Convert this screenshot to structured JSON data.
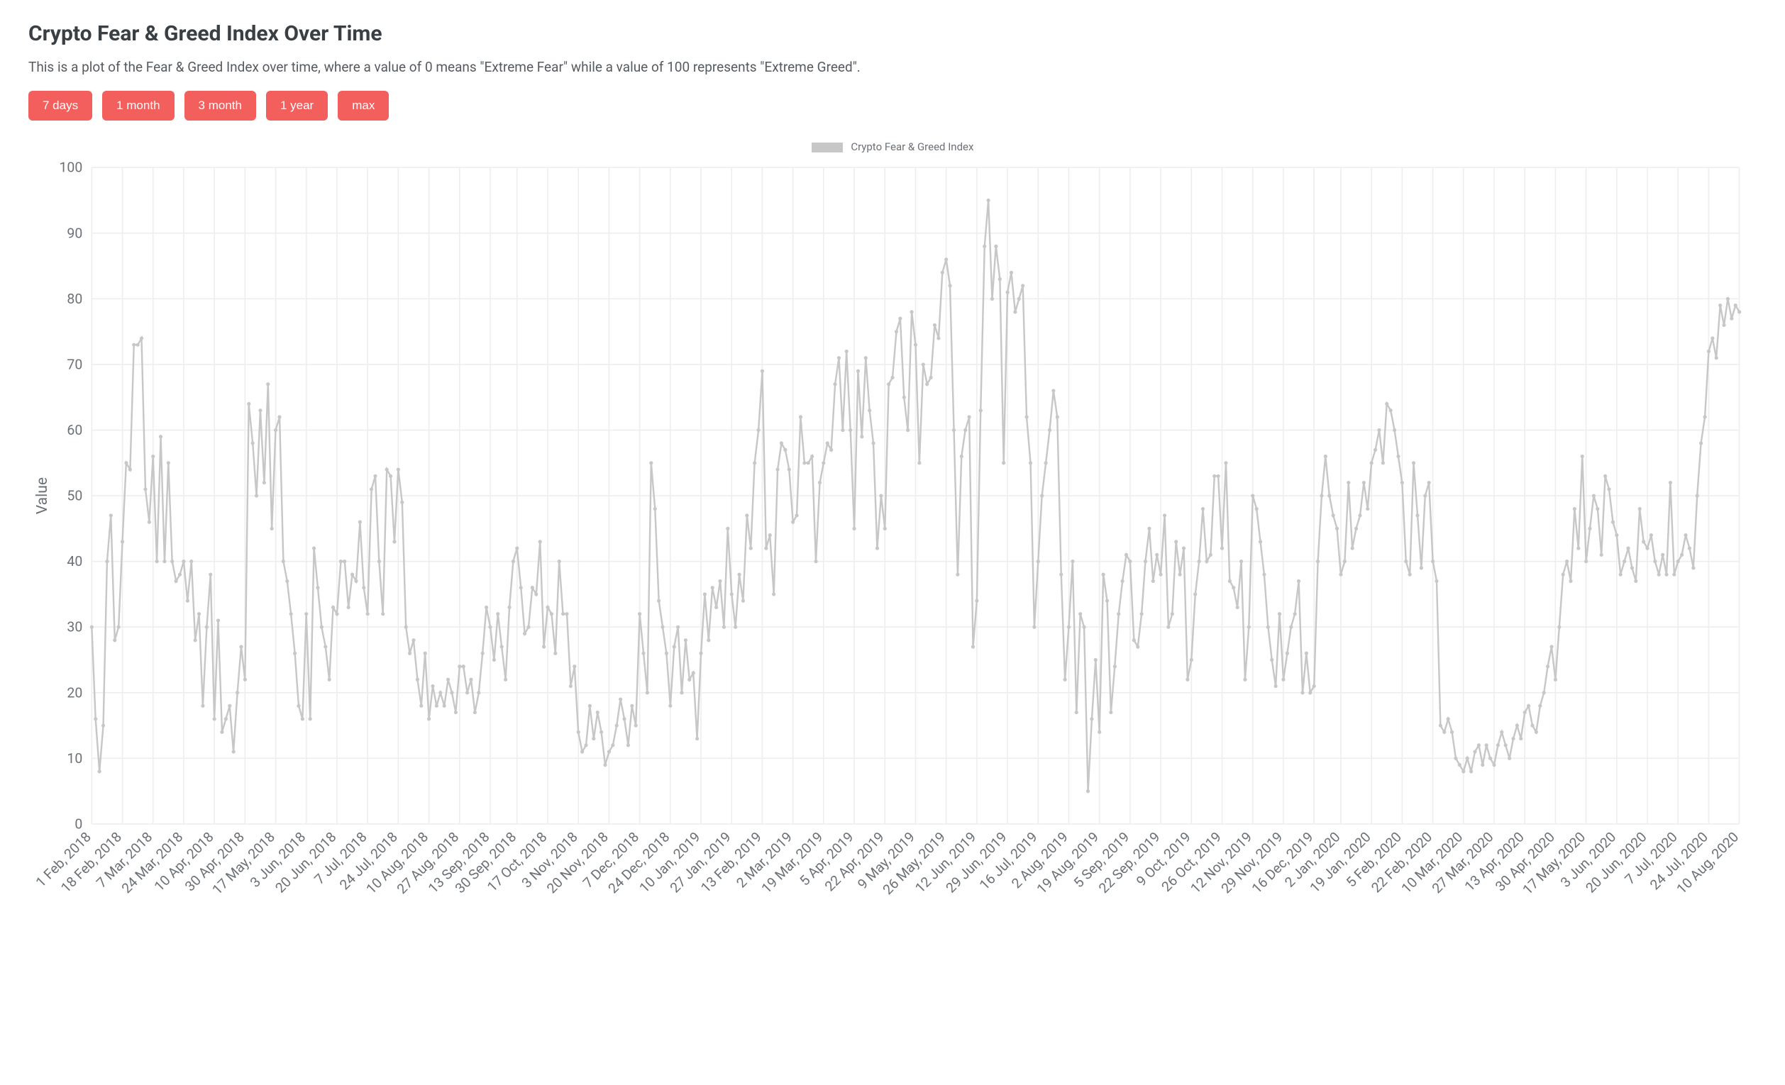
{
  "header": {
    "title": "Crypto Fear & Greed Index Over Time",
    "description": "This is a plot of the Fear & Greed Index over time, where a value of 0 means \"Extreme Fear\" while a value of 100 represents \"Extreme Greed\"."
  },
  "range_buttons": {
    "d7": "7 days",
    "m1": "1 month",
    "m3": "3 month",
    "y1": "1 year",
    "max": "max"
  },
  "legend_label": "Crypto Fear & Greed Index",
  "chart_data": {
    "type": "line",
    "title": "Crypto Fear & Greed Index",
    "xlabel": "",
    "ylabel": "Value",
    "ylim": [
      0,
      100
    ],
    "y_ticks": [
      0,
      10,
      20,
      30,
      40,
      50,
      60,
      70,
      80,
      90,
      100
    ],
    "x_tick_labels": [
      "1 Feb, 2018",
      "18 Feb, 2018",
      "7 Mar, 2018",
      "24 Mar, 2018",
      "10 Apr, 2018",
      "30 Apr, 2018",
      "17 May, 2018",
      "3 Jun, 2018",
      "20 Jun, 2018",
      "7 Jul, 2018",
      "24 Jul, 2018",
      "10 Aug, 2018",
      "27 Aug, 2018",
      "13 Sep, 2018",
      "30 Sep, 2018",
      "17 Oct, 2018",
      "3 Nov, 2018",
      "20 Nov, 2018",
      "7 Dec, 2018",
      "24 Dec, 2018",
      "10 Jan, 2019",
      "27 Jan, 2019",
      "13 Feb, 2019",
      "2 Mar, 2019",
      "19 Mar, 2019",
      "5 Apr, 2019",
      "22 Apr, 2019",
      "9 May, 2019",
      "26 May, 2019",
      "12 Jun, 2019",
      "29 Jun, 2019",
      "16 Jul, 2019",
      "2 Aug, 2019",
      "19 Aug, 2019",
      "5 Sep, 2019",
      "22 Sep, 2019",
      "9 Oct, 2019",
      "26 Oct, 2019",
      "12 Nov, 2019",
      "29 Nov, 2019",
      "16 Dec, 2019",
      "2 Jan, 2020",
      "19 Jan, 2020",
      "5 Feb, 2020",
      "22 Feb, 2020",
      "10 Mar, 2020",
      "27 Mar, 2020",
      "13 Apr, 2020",
      "30 Apr, 2020",
      "17 May, 2020",
      "3 Jun, 2020",
      "20 Jun, 2020",
      "7 Jul, 2020",
      "24 Jul, 2020",
      "10 Aug, 2020"
    ],
    "series": [
      {
        "name": "Crypto Fear & Greed Index",
        "values": [
          30,
          16,
          8,
          15,
          40,
          47,
          28,
          30,
          43,
          55,
          54,
          73,
          73,
          74,
          51,
          46,
          56,
          40,
          59,
          40,
          55,
          40,
          37,
          38,
          40,
          34,
          40,
          28,
          32,
          18,
          30,
          38,
          16,
          31,
          14,
          16,
          18,
          11,
          20,
          27,
          22,
          64,
          58,
          50,
          63,
          52,
          67,
          45,
          60,
          62,
          40,
          37,
          32,
          26,
          18,
          16,
          32,
          16,
          42,
          36,
          30,
          27,
          22,
          33,
          32,
          40,
          40,
          33,
          38,
          37,
          46,
          36,
          32,
          51,
          53,
          40,
          32,
          54,
          53,
          43,
          54,
          49,
          30,
          26,
          28,
          22,
          18,
          26,
          16,
          21,
          18,
          20,
          18,
          22,
          20,
          17,
          24,
          24,
          20,
          22,
          17,
          20,
          26,
          33,
          30,
          25,
          32,
          27,
          22,
          33,
          40,
          42,
          36,
          29,
          30,
          36,
          35,
          43,
          27,
          33,
          32,
          26,
          40,
          32,
          32,
          21,
          24,
          14,
          11,
          12,
          18,
          13,
          17,
          14,
          9,
          11,
          12,
          15,
          19,
          16,
          12,
          18,
          15,
          32,
          26,
          20,
          55,
          48,
          34,
          30,
          26,
          18,
          27,
          30,
          20,
          28,
          22,
          23,
          13,
          26,
          35,
          28,
          36,
          33,
          37,
          30,
          45,
          35,
          30,
          38,
          34,
          47,
          42,
          55,
          60,
          69,
          42,
          44,
          35,
          54,
          58,
          57,
          54,
          46,
          47,
          62,
          55,
          55,
          56,
          40,
          52,
          55,
          58,
          57,
          67,
          71,
          60,
          72,
          60,
          45,
          69,
          59,
          71,
          63,
          58,
          42,
          50,
          45,
          67,
          68,
          75,
          77,
          65,
          60,
          78,
          73,
          55,
          70,
          67,
          68,
          76,
          74,
          84,
          86,
          82,
          60,
          38,
          56,
          60,
          62,
          27,
          34,
          63,
          88,
          95,
          80,
          88,
          83,
          55,
          81,
          84,
          78,
          80,
          82,
          62,
          55,
          30,
          40,
          50,
          55,
          60,
          66,
          62,
          38,
          22,
          30,
          40,
          17,
          32,
          30,
          5,
          16,
          25,
          14,
          38,
          34,
          17,
          24,
          32,
          37,
          41,
          40,
          28,
          27,
          32,
          40,
          45,
          37,
          41,
          38,
          47,
          30,
          32,
          43,
          38,
          42,
          22,
          25,
          35,
          40,
          48,
          40,
          41,
          53,
          53,
          42,
          55,
          37,
          36,
          33,
          40,
          22,
          30,
          50,
          48,
          43,
          38,
          30,
          25,
          21,
          32,
          22,
          26,
          30,
          32,
          37,
          20,
          26,
          20,
          21,
          40,
          50,
          56,
          50,
          47,
          45,
          38,
          40,
          52,
          42,
          45,
          47,
          52,
          48,
          55,
          57,
          60,
          55,
          64,
          63,
          60,
          56,
          52,
          40,
          38,
          55,
          47,
          39,
          50,
          52,
          40,
          37,
          15,
          14,
          16,
          14,
          10,
          9,
          8,
          10,
          8,
          11,
          12,
          9,
          12,
          10,
          9,
          12,
          14,
          12,
          10,
          13,
          15,
          13,
          17,
          18,
          15,
          14,
          18,
          20,
          24,
          27,
          22,
          30,
          38,
          40,
          37,
          48,
          42,
          56,
          40,
          45,
          50,
          48,
          41,
          53,
          51,
          46,
          44,
          38,
          40,
          42,
          39,
          37,
          48,
          43,
          42,
          44,
          40,
          38,
          41,
          38,
          52,
          38,
          40,
          41,
          44,
          42,
          39,
          50,
          58,
          62,
          72,
          74,
          71,
          79,
          76,
          80,
          77,
          79,
          78
        ]
      }
    ]
  }
}
